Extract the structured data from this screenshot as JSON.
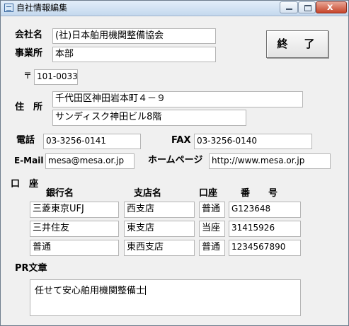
{
  "window": {
    "title": "自社情報編集",
    "close_glyph": "x"
  },
  "buttons": {
    "end": "終　了"
  },
  "labels": {
    "company": "会社名",
    "office": "事業所",
    "postal_mark": "〒",
    "address": "住　所",
    "phone": "電話",
    "fax": "FAX",
    "email": "E-Mail",
    "homepage": "ホームページ",
    "account": "口　座",
    "bank_name": "銀行名",
    "branch_name": "支店名",
    "account_type": "口座",
    "account_number": "番　　号",
    "pr": "PR文章"
  },
  "fields": {
    "company": "(社)日本舶用機関整備協会",
    "office": "本部",
    "postal": "101-0033",
    "address1": "千代田区神田岩本町４－９",
    "address2": "サンディスク神田ビル8階",
    "phone": "03-3256-0141",
    "fax": "03-3256-0140",
    "email": "mesa@mesa.or.jp",
    "homepage": "http://www.mesa.or.jp",
    "pr": "任せて安心舶用機関整備士"
  },
  "accounts": [
    {
      "bank": "三菱東京UFJ",
      "branch": "西支店",
      "type": "普通",
      "number": "G123648"
    },
    {
      "bank": "三井住友",
      "branch": "東支店",
      "type": "当座",
      "number": "31415926"
    },
    {
      "bank": "普通",
      "branch": "東西支店",
      "type": "普通",
      "number": "1234567890"
    }
  ],
  "colors": {
    "window_bg": "#f0f0f0",
    "field_border": "#b5b5b5",
    "close_button": "#c6452b"
  }
}
